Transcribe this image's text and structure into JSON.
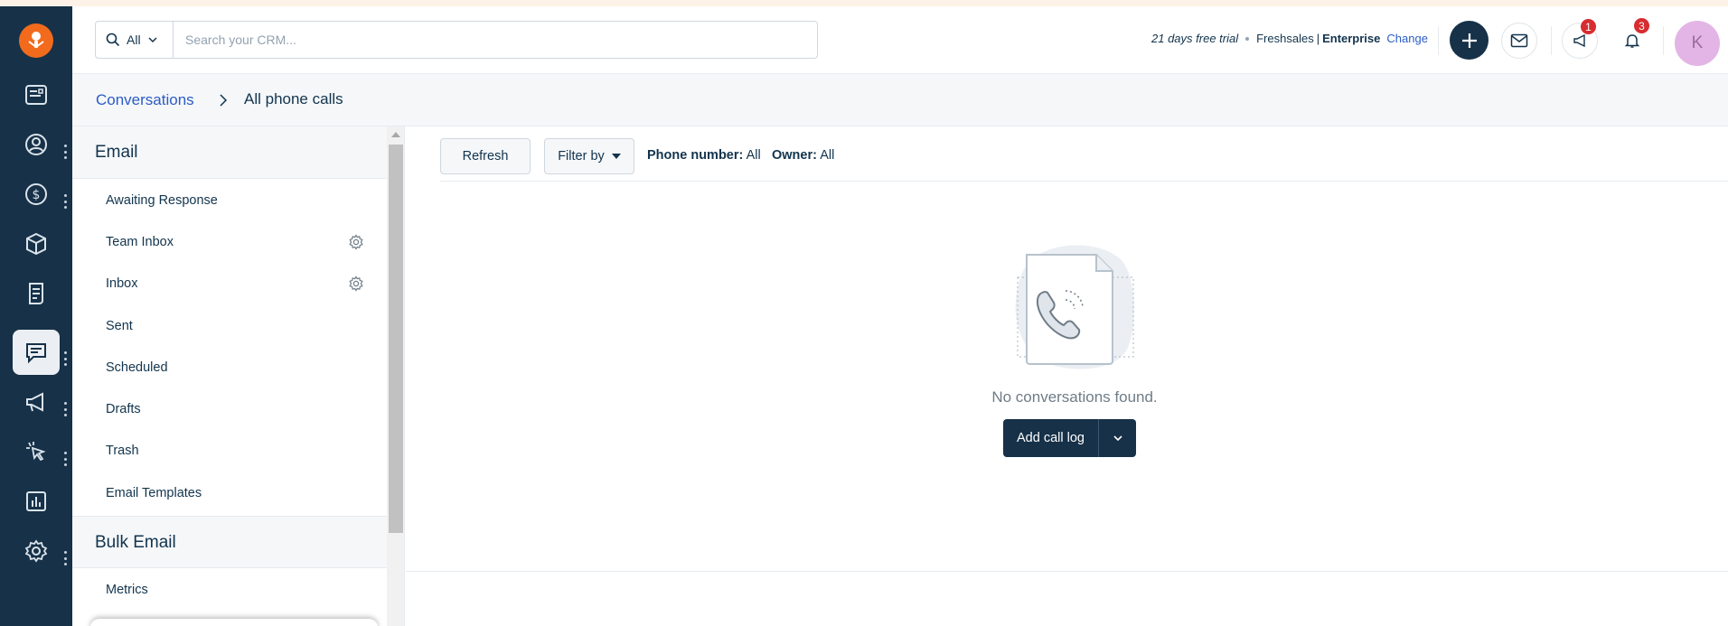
{
  "app": {
    "brand_color": "#f26b1d",
    "rail_color": "#163148",
    "accent": "#2c5cc5"
  },
  "rail": {
    "items": [
      {
        "icon": "card-icon"
      },
      {
        "icon": "contact-icon"
      },
      {
        "icon": "dollar-icon"
      },
      {
        "icon": "box-icon"
      },
      {
        "icon": "document-icon"
      },
      {
        "icon": "chat-icon",
        "active": true
      },
      {
        "icon": "megaphone-icon"
      },
      {
        "icon": "cursor-click-icon"
      },
      {
        "icon": "report-icon"
      },
      {
        "icon": "gear-icon"
      }
    ]
  },
  "header": {
    "search_scope": "All",
    "search_placeholder": "Search your CRM...",
    "trial_text": "21 days free trial",
    "product": "Freshsales",
    "separator": "|",
    "plan": "Enterprise",
    "change_link": "Change",
    "campaign_badge": "1",
    "notification_badge": "3",
    "avatar_letter": "K"
  },
  "breadcrumb": {
    "parent": "Conversations",
    "current": "All phone calls"
  },
  "sidebar": {
    "email_heading": "Email",
    "email_items": [
      {
        "label": "Awaiting Response",
        "gear": false
      },
      {
        "label": "Team Inbox",
        "gear": true
      },
      {
        "label": "Inbox",
        "gear": true
      },
      {
        "label": "Sent",
        "gear": false
      },
      {
        "label": "Scheduled",
        "gear": false
      },
      {
        "label": "Drafts",
        "gear": false
      },
      {
        "label": "Trash",
        "gear": false
      },
      {
        "label": "Email Templates",
        "gear": false
      }
    ],
    "bulk_heading": "Bulk Email",
    "bulk_items": [
      {
        "label": "Metrics"
      }
    ]
  },
  "toolbar": {
    "refresh_label": "Refresh",
    "filter_label": "Filter by",
    "phone_filter_key": "Phone number:",
    "phone_filter_value": "All",
    "owner_filter_key": "Owner:",
    "owner_filter_value": "All"
  },
  "empty_state": {
    "message": "No conversations found.",
    "add_button_label": "Add call log"
  }
}
